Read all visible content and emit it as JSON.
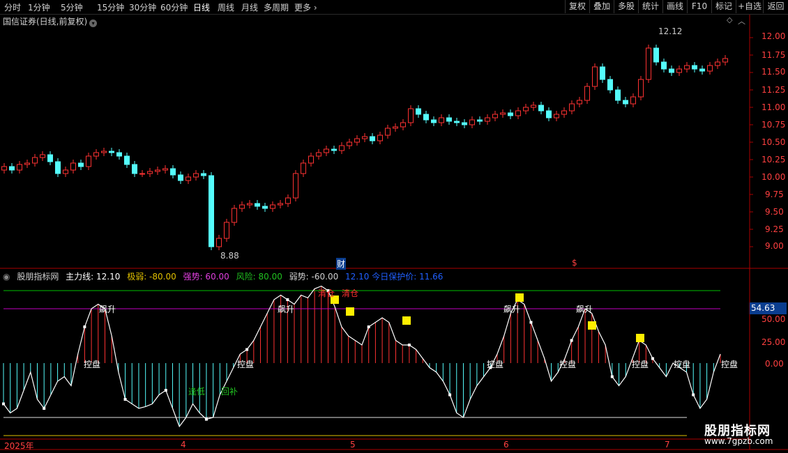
{
  "toolbar": {
    "periods": [
      "分时",
      "1分钟",
      "5分钟",
      "15分钟",
      "30分钟",
      "60分钟",
      "日线",
      "周线",
      "月线",
      "多周期",
      "更多"
    ],
    "active_period": "日线",
    "buttons": [
      "复权",
      "叠加",
      "多股",
      "统计",
      "画线",
      "F10",
      "标记",
      "+自选",
      "返回"
    ]
  },
  "stock": {
    "title": "国信证券(日线,前复权)"
  },
  "price_axis": [
    "12.00",
    "11.75",
    "11.50",
    "11.25",
    "11.00",
    "10.75",
    "10.50",
    "10.25",
    "10.00",
    "9.75",
    "9.50",
    "9.25",
    "9.00"
  ],
  "annotations": {
    "high": "12.12",
    "low": "8.88",
    "cai": "财",
    "s": "$"
  },
  "indicator": {
    "name": "股朋指标网",
    "main_line": "主力线: 12.10",
    "extreme_weak": "极弱: -80.00",
    "strong": "强势: 60.00",
    "risk": "风险: 80.00",
    "weak": "弱势: -60.00",
    "extra": "12.10  今日保护价: 11.66",
    "badge": "54.63",
    "axis": [
      "50.00",
      "25.00",
      "0.00"
    ],
    "labels": {
      "rise": "飙升",
      "control": "控盘",
      "clear": "清仓",
      "dip": "逢低",
      "add": "回补"
    }
  },
  "date_axis": [
    "2025年",
    "4",
    "5",
    "6",
    "7"
  ],
  "watermark": {
    "name": "股朋指标网",
    "url": "www.7gpzb.com"
  },
  "colors": {
    "up": "#ff3232",
    "down": "#54fcfc",
    "risk": "#00c000",
    "strong": "#c000c0",
    "weak": "#e0e0e0",
    "extreme": "#e0c000"
  }
}
